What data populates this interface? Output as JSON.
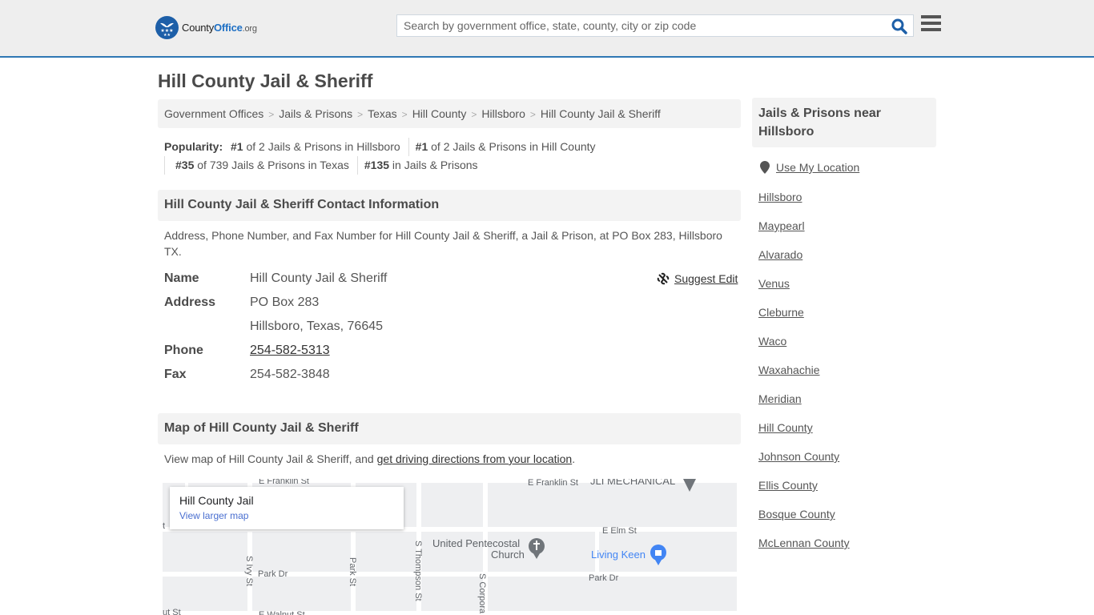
{
  "header": {
    "logo": {
      "county": "County",
      "office": "Office",
      "org": ".org"
    },
    "search": {
      "placeholder": "Search by government office, state, county, city or zip code",
      "value": ""
    },
    "search_icon": "search-icon",
    "menu_icon": "hamburger-menu-icon"
  },
  "page": {
    "title": "Hill County Jail & Sheriff"
  },
  "breadcrumb": [
    "Government Offices",
    "Jails & Prisons",
    "Texas",
    "Hill County",
    "Hillsboro",
    "Hill County Jail & Sheriff"
  ],
  "popularity": {
    "label": "Popularity:",
    "items": [
      {
        "rank": "#1",
        "text": " of 2 Jails & Prisons in Hillsboro"
      },
      {
        "rank": "#1",
        "text": " of 2 Jails & Prisons in Hill County"
      },
      {
        "rank": "#35",
        "text": " of 739 Jails & Prisons in Texas"
      },
      {
        "rank": "#135",
        "text": " in Jails & Prisons"
      }
    ]
  },
  "contact": {
    "header": "Hill County Jail & Sheriff Contact Information",
    "description": "Address, Phone Number, and Fax Number for Hill County Jail & Sheriff, a Jail & Prison, at PO Box 283, Hillsboro TX.",
    "suggest_edit": "Suggest Edit",
    "fields": {
      "name_label": "Name",
      "name_value": "Hill County Jail & Sheriff",
      "address_label": "Address",
      "address_line1": "PO Box 283",
      "address_line2": "Hillsboro, Texas, 76645",
      "phone_label": "Phone",
      "phone_value": "254-582-5313",
      "fax_label": "Fax",
      "fax_value": "254-582-3848"
    }
  },
  "map_section": {
    "header": "Map of Hill County Jail & Sheriff",
    "desc_prefix": "View map of Hill County Jail & Sheriff, and ",
    "directions_link": "get driving directions from your location",
    "desc_suffix": ".",
    "card_title": "Hill County Jail",
    "card_link": "View larger map",
    "labels": {
      "e_franklin_1": "E Franklin St",
      "e_franklin_2": "E Franklin St",
      "jli": "JLI MECHANICAL",
      "e_elm": "E Elm St",
      "church_1": "United Pentecostal",
      "church_2": "Church",
      "living_keen": "Living Keen",
      "park_dr_1": "Park Dr",
      "park_dr_2": "Park Dr",
      "s_ivy": "S Ivy St",
      "park_st": "Park St",
      "s_thompson": "S Thompson St",
      "s_corpora": "S Corpora",
      "e_walnut": "E Walnut St",
      "ut_st": "ut St",
      "t": "t"
    }
  },
  "sidebar": {
    "header": "Jails & Prisons near Hillsboro",
    "use_location": "Use My Location",
    "links": [
      "Hillsboro",
      "Maypearl",
      "Alvarado",
      "Venus",
      "Cleburne",
      "Waco",
      "Waxahachie",
      "Meridian",
      "Hill County",
      "Johnson County",
      "Ellis County",
      "Bosque County",
      "McLennan County"
    ]
  },
  "colors": {
    "brand_blue": "#1d5fa8",
    "header_border": "#2f77b4",
    "map_link": "#4a6fd0",
    "poi_blue": "#4285f4",
    "poi_gray": "#70757a"
  }
}
